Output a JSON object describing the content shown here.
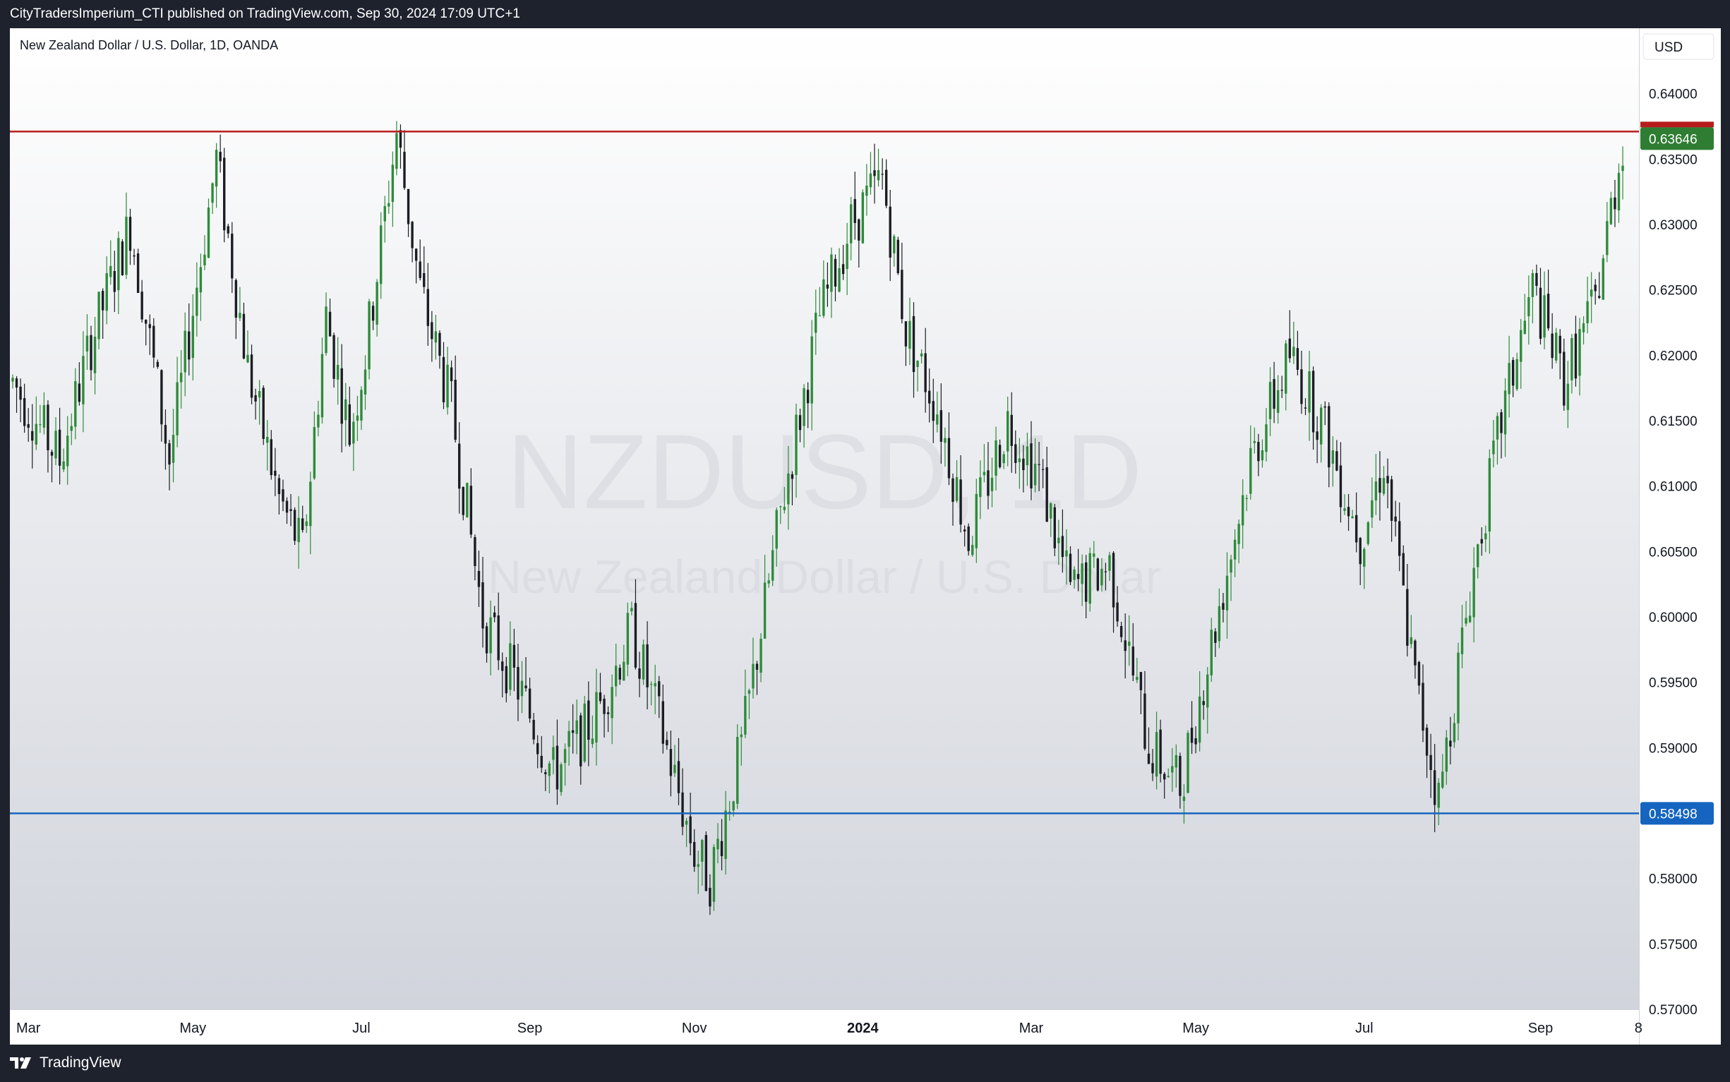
{
  "header": {
    "publisher_line": "CityTradersImperium_CTI published on TradingView.com, Sep 30, 2024 17:09 UTC+1"
  },
  "chart": {
    "symbol_line": "New Zealand Dollar / U.S. Dollar, 1D, OANDA",
    "currency_label": "USD",
    "watermark_ticker": "NZDUSD, 1D",
    "watermark_name": "New Zealand Dollar / U.S. Dollar"
  },
  "footer": {
    "brand": "TradingView"
  },
  "colors": {
    "up": "#2e8b3a",
    "down": "#1b1d24",
    "resistance": "#b71c1c",
    "support": "#1565c0",
    "last_price_bg": "#2e7d32",
    "support_label_bg": "#1565c0"
  },
  "chart_data": {
    "type": "candlestick",
    "title": "New Zealand Dollar / U.S. Dollar, 1D, OANDA",
    "ylim": [
      0.57,
      0.645
    ],
    "y_ticks": [
      "0.64000",
      "0.63500",
      "0.63000",
      "0.62500",
      "0.62000",
      "0.61500",
      "0.61000",
      "0.60500",
      "0.60000",
      "0.59500",
      "0.59000",
      "0.58000",
      "0.57500",
      "0.57000"
    ],
    "x_ticks": [
      {
        "label": "Mar",
        "bar": 4
      },
      {
        "label": "May",
        "bar": 46
      },
      {
        "label": "Jul",
        "bar": 89
      },
      {
        "label": "Sep",
        "bar": 132
      },
      {
        "label": "Nov",
        "bar": 174
      },
      {
        "label": "2024",
        "bar": 217
      },
      {
        "label": "Mar",
        "bar": 260
      },
      {
        "label": "May",
        "bar": 302
      },
      {
        "label": "Jul",
        "bar": 345
      },
      {
        "label": "Sep",
        "bar": 390
      },
      {
        "label": "8",
        "bar": 415
      }
    ],
    "bar_count": 412,
    "price_path": [
      [
        0,
        0.618
      ],
      [
        12,
        0.612
      ],
      [
        20,
        0.621
      ],
      [
        30,
        0.63
      ],
      [
        40,
        0.612
      ],
      [
        52,
        0.635
      ],
      [
        60,
        0.619
      ],
      [
        68,
        0.609
      ],
      [
        74,
        0.605
      ],
      [
        80,
        0.623
      ],
      [
        86,
        0.614
      ],
      [
        90,
        0.62
      ],
      [
        98,
        0.637
      ],
      [
        104,
        0.625
      ],
      [
        112,
        0.616
      ],
      [
        120,
        0.6
      ],
      [
        130,
        0.594
      ],
      [
        138,
        0.588
      ],
      [
        148,
        0.592
      ],
      [
        158,
        0.599
      ],
      [
        166,
        0.591
      ],
      [
        174,
        0.582
      ],
      [
        178,
        0.58
      ],
      [
        186,
        0.59
      ],
      [
        196,
        0.608
      ],
      [
        206,
        0.623
      ],
      [
        214,
        0.63
      ],
      [
        222,
        0.6335
      ],
      [
        228,
        0.622
      ],
      [
        236,
        0.616
      ],
      [
        244,
        0.606
      ],
      [
        254,
        0.615
      ],
      [
        262,
        0.611
      ],
      [
        270,
        0.602
      ],
      [
        280,
        0.604
      ],
      [
        290,
        0.59
      ],
      [
        298,
        0.587
      ],
      [
        306,
        0.598
      ],
      [
        316,
        0.612
      ],
      [
        326,
        0.62
      ],
      [
        334,
        0.615
      ],
      [
        344,
        0.606
      ],
      [
        350,
        0.612
      ],
      [
        358,
        0.595
      ],
      [
        364,
        0.586
      ],
      [
        372,
        0.602
      ],
      [
        380,
        0.615
      ],
      [
        388,
        0.625
      ],
      [
        396,
        0.618
      ],
      [
        404,
        0.624
      ],
      [
        411,
        0.6364
      ]
    ],
    "current_price": "0.63646",
    "lines": [
      {
        "name": "resistance",
        "price": 0.6371,
        "label": "0.63646"
      },
      {
        "name": "support",
        "price": 0.58498,
        "label": "0.58498"
      }
    ]
  }
}
